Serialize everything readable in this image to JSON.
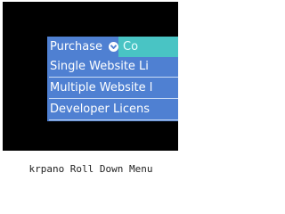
{
  "menu": {
    "top_items": [
      {
        "label": "Purchase",
        "icon": "chevron-down-icon"
      },
      {
        "label": "Co"
      }
    ],
    "submenu_items": [
      {
        "label": "Single Website Li"
      },
      {
        "label": "Multiple Website l"
      },
      {
        "label": "Developer Licens"
      }
    ]
  },
  "caption": "krpano Roll Down Menu",
  "colors": {
    "background": "#000000",
    "menu_blue": "#4f80d2",
    "active_teal": "#49c4c4",
    "text": "#ffffff",
    "separator": "#c9dbf5"
  }
}
